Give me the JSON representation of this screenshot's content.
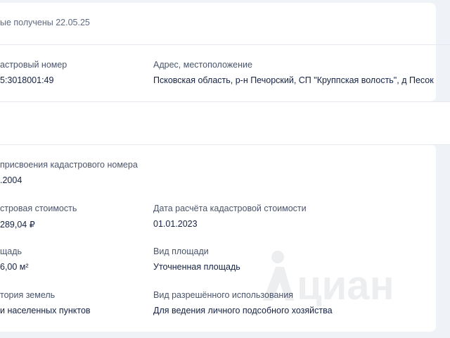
{
  "header": {
    "data_received": "ые получены 22.05.25"
  },
  "top_section": {
    "cadastral_number_label": "астровый номер",
    "cadastral_number_value": "5:3018001:49",
    "address_label": "Адрес, местоположение",
    "address_value": "Псковская область, р-н Печорский, СП \"Круппская волость\", д Песок"
  },
  "details": {
    "assignment_date_label": "присвоения кадастрового номера",
    "assignment_date_value": ".2004",
    "cadastral_value_label": "стровая стоимость",
    "cadastral_value_value": "289,04 ₽",
    "calc_date_label": "Дата расчёта кадастровой стоимости",
    "calc_date_value": "01.01.2023",
    "area_label": "щадь",
    "area_value": "6,00 м²",
    "area_type_label": "Вид площади",
    "area_type_value": "Уточненная площадь",
    "land_category_label": "тория земель",
    "land_category_value": "и населенных пунктов",
    "permitted_use_label": "Вид разрешённого использования",
    "permitted_use_value": "Для ведения личного подсобного хозяйства"
  },
  "watermark": {
    "icon": "cian-logo-icon",
    "text": "циан"
  }
}
